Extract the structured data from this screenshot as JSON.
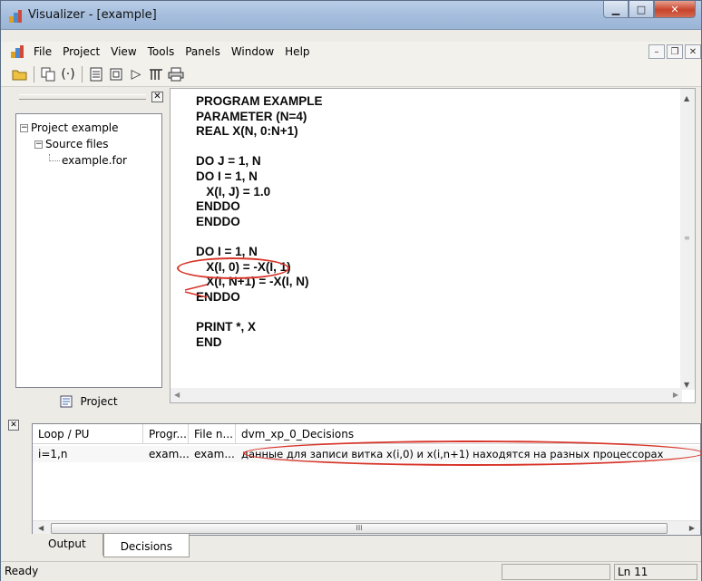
{
  "window": {
    "title": "Visualizer - [example]"
  },
  "menu": {
    "items": [
      "File",
      "Project",
      "View",
      "Tools",
      "Panels",
      "Window",
      "Help"
    ]
  },
  "project_pane": {
    "tree": [
      {
        "label": "Project example",
        "expander": "−",
        "level": 0
      },
      {
        "label": "Source files",
        "expander": "−",
        "level": 1
      },
      {
        "label": "example.for",
        "expander": "",
        "level": 2
      }
    ],
    "tab_label": "Project"
  },
  "editor": {
    "code": "PROGRAM EXAMPLE\nPARAMETER (N=4)\nREAL X(N, 0:N+1)\n\nDO J = 1, N\nDO I = 1, N\n   X(I, J) = 1.0\nENDDO\nENDDO\n\nDO I = 1, N\n   X(I, 0) = -X(I, 1)\n   X(I, N+1) = -X(I, N)\nENDDO\n\nPRINT *, X\nEND"
  },
  "decisions": {
    "columns": [
      "Loop / PU",
      "Progr...",
      "File n...",
      "dvm_xp_0_Decisions"
    ],
    "rows": [
      [
        "i=1,n",
        "exam...",
        "exam...",
        "данные для записи витка x(i,0) и x(i,n+1) находятся на разных процессорах"
      ]
    ],
    "scroll_mark": "III"
  },
  "bottom_tabs": [
    "Output",
    "Decisions"
  ],
  "status": {
    "text": "Ready",
    "line": "Ln 11"
  },
  "colors": {
    "annotation": "#d8352a",
    "titlebar": "#a6bedd"
  }
}
